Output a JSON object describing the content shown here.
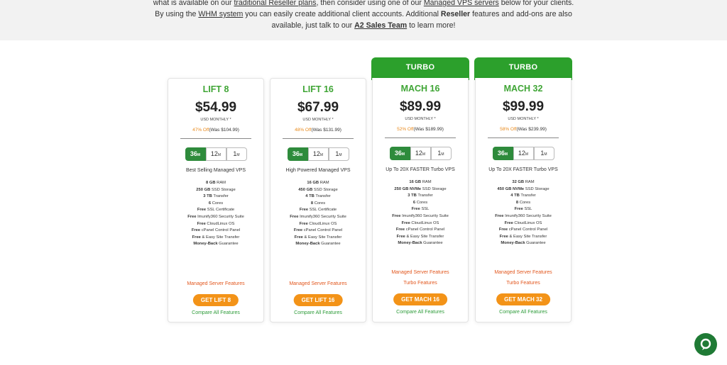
{
  "intro": {
    "line1_a": "what is available on our ",
    "link_reseller": "traditional Reseller plans",
    "line1_b": ", then consider using one of our ",
    "link_vps": "Managed VPS servers",
    "line1_c": " below for your clients.",
    "line2_a": "By using the ",
    "link_whm": "WHM system",
    "line2_b": " you can easily create additional client accounts. Additional ",
    "reseller_bold": "Reseller",
    "line2_c": " features and add-ons are also",
    "line3_a": "available, just talk to our ",
    "link_sales": "A2 Sales Team",
    "line3_b": " to learn more!"
  },
  "usd_label": "USD MONTHLY *",
  "terms": [
    {
      "num": "36",
      "unit": "M"
    },
    {
      "num": "12",
      "unit": "M"
    },
    {
      "num": "1",
      "unit": "M"
    }
  ],
  "plans": [
    {
      "name": "LIFT 8",
      "turbo": "",
      "price": "$54.99",
      "off": "47% Off",
      "was": "(Was $104.99)",
      "tagline": "Best Selling Managed VPS",
      "specs": [
        {
          "b": "8 GB",
          "t": " RAM"
        },
        {
          "b": "250 GB",
          "t": " SSD Storage"
        },
        {
          "b": "3 TB",
          "t": " Transfer"
        },
        {
          "b": "6",
          "t": " Cores"
        },
        {
          "b": "Free",
          "t": " SSL Certificate"
        },
        {
          "b": "Free",
          "t": " Imunify360 Security Suite"
        },
        {
          "b": "Free",
          "t": " CloudLinux OS"
        },
        {
          "b": "Free",
          "t": " cPanel Control Panel"
        },
        {
          "b": "Free",
          "t": " & Easy Site Transfer"
        },
        {
          "b": "Money-Back",
          "t": " Guarantee"
        }
      ],
      "links": [
        "Managed Server Features"
      ],
      "button": "GET LIFT 8",
      "compare": "Compare All Features"
    },
    {
      "name": "LIFT 16",
      "turbo": "",
      "price": "$67.99",
      "off": "48% Off",
      "was": "(Was $131.99)",
      "tagline": "High Powered Managed VPS",
      "specs": [
        {
          "b": "16 GB",
          "t": " RAM"
        },
        {
          "b": "450 GB",
          "t": " SSD Storage"
        },
        {
          "b": "4 TB",
          "t": " Transfer"
        },
        {
          "b": "8",
          "t": " Cores"
        },
        {
          "b": "Free",
          "t": " SSL Certificate"
        },
        {
          "b": "Free",
          "t": " Imunify360 Security Suite"
        },
        {
          "b": "Free",
          "t": " CloudLinux OS"
        },
        {
          "b": "Free",
          "t": " cPanel Control Panel"
        },
        {
          "b": "Free",
          "t": " & Easy Site Transfer"
        },
        {
          "b": "Money-Back",
          "t": " Guarantee"
        }
      ],
      "links": [
        "Managed Server Features"
      ],
      "button": "GET LIFT 16",
      "compare": "Compare All Features"
    },
    {
      "name": "MACH 16",
      "turbo": "TURBO",
      "price": "$89.99",
      "off": "52% Off",
      "was": "(Was $189.99)",
      "tagline": "Up To 20X FASTER Turbo VPS",
      "specs": [
        {
          "b": "16 GB",
          "t": " RAM"
        },
        {
          "b": "250 GB NVMe",
          "t": " SSD Storage"
        },
        {
          "b": "3 TB",
          "t": " Transfer"
        },
        {
          "b": "6",
          "t": " Cores"
        },
        {
          "b": "Free",
          "t": " SSL"
        },
        {
          "b": "Free",
          "t": " Imunify360 Security Suite"
        },
        {
          "b": "Free",
          "t": " CloudLinux OS"
        },
        {
          "b": "Free",
          "t": " cPanel Control Panel"
        },
        {
          "b": "Free",
          "t": " & Easy Site Transfer"
        },
        {
          "b": "Money-Back",
          "t": " Guarantee"
        }
      ],
      "links": [
        "Managed Server Features",
        "Turbo Features"
      ],
      "button": "GET MACH 16",
      "compare": "Compare All Features"
    },
    {
      "name": "MACH 32",
      "turbo": "TURBO",
      "price": "$99.99",
      "off": "58% Off",
      "was": "(Was $239.99)",
      "tagline": "Up To 20X FASTER Turbo VPS",
      "specs": [
        {
          "b": "32 GB",
          "t": " RAM"
        },
        {
          "b": "450 GB NVMe",
          "t": " SSD Storage"
        },
        {
          "b": "4 TB",
          "t": " Transfer"
        },
        {
          "b": "8",
          "t": " Cores"
        },
        {
          "b": "Free",
          "t": " SSL"
        },
        {
          "b": "Free",
          "t": " Imunify360 Security Suite"
        },
        {
          "b": "Free",
          "t": " CloudLinux OS"
        },
        {
          "b": "Free",
          "t": " cPanel Control Panel"
        },
        {
          "b": "Free",
          "t": " & Easy Site Transfer"
        },
        {
          "b": "Money-Back",
          "t": " Guarantee"
        }
      ],
      "links": [
        "Managed Server Features",
        "Turbo Features"
      ],
      "button": "GET MACH 32",
      "compare": "Compare All Features"
    }
  ],
  "chat": {
    "icon": "chat-bubble-icon"
  },
  "colors": {
    "green": "#3fa535",
    "orange": "#f39318",
    "link_orange": "#e2571e",
    "turbo_green": "#2ca02c"
  }
}
